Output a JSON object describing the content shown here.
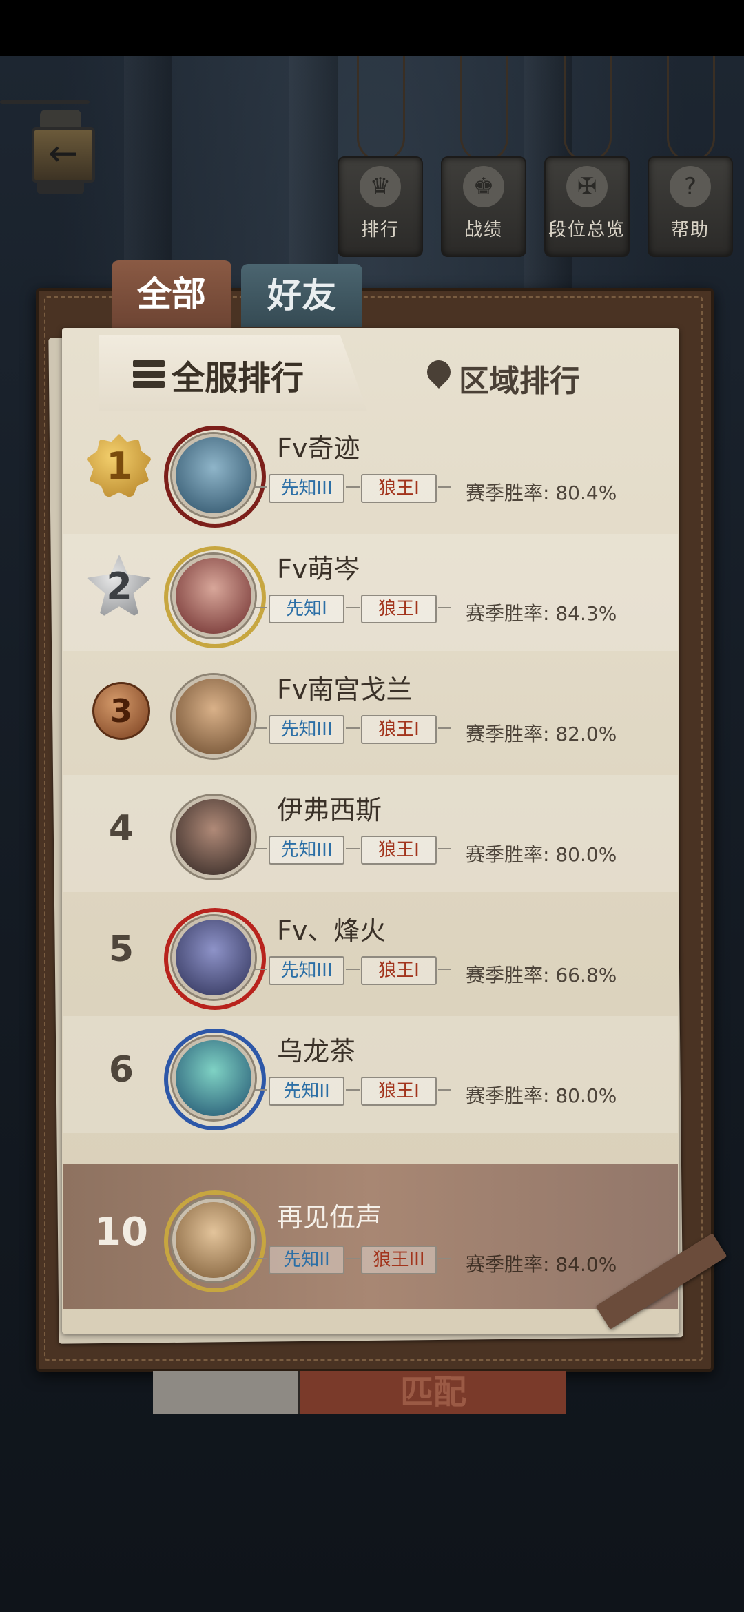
{
  "nav": {
    "back_icon": "back-arrow-icon",
    "top_buttons": [
      {
        "label": "排行",
        "icon": "trophy-icon"
      },
      {
        "label": "战绩",
        "icon": "crown-icon"
      },
      {
        "label": "段位总览",
        "icon": "sword-emblem-icon"
      },
      {
        "label": "帮助",
        "icon": "scroll-help-icon"
      }
    ]
  },
  "tabs": {
    "all": "全部",
    "friends": "好友"
  },
  "subtabs": {
    "global": "全服排行",
    "region": "区域排行"
  },
  "rate_prefix": "赛季胜率: ",
  "rows": [
    {
      "rank": "1",
      "name": "Fv奇迹",
      "b1": "先知III",
      "b2": "狼王I",
      "rate": "80.4%"
    },
    {
      "rank": "2",
      "name": "Fv萌岑",
      "b1": "先知I",
      "b2": "狼王I",
      "rate": "84.3%"
    },
    {
      "rank": "3",
      "name": "Fv南宫戈兰",
      "b1": "先知III",
      "b2": "狼王I",
      "rate": "82.0%"
    },
    {
      "rank": "4",
      "name": "伊弗西斯",
      "b1": "先知III",
      "b2": "狼王I",
      "rate": "80.0%"
    },
    {
      "rank": "5",
      "name": "Fv、烽火",
      "b1": "先知III",
      "b2": "狼王I",
      "rate": "66.8%"
    },
    {
      "rank": "6",
      "name": "乌龙茶",
      "b1": "先知II",
      "b2": "狼王I",
      "rate": "80.0%"
    }
  ],
  "self": {
    "rank": "10",
    "name": "再见伍声",
    "b1": "先知II",
    "b2": "狼王III",
    "rate": "84.0%"
  },
  "bottom": {
    "match_label": "匹配"
  },
  "colors": {
    "gold": "#c9922e",
    "silver": "#9a9da1",
    "bronze": "#a4572c",
    "accent_blue": "#2c6fa6",
    "accent_red": "#a2341c"
  }
}
